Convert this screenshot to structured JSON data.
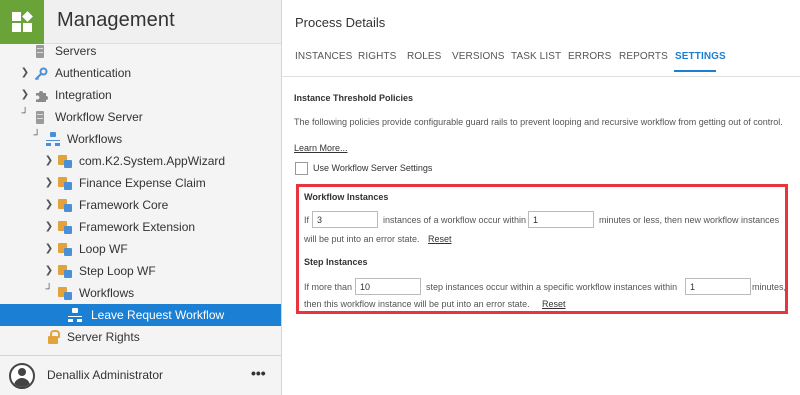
{
  "app": {
    "title": "Management"
  },
  "sidebar": {
    "items": [
      {
        "label": "Servers",
        "icon": "server-icon"
      },
      {
        "label": "Authentication",
        "icon": "key-icon"
      },
      {
        "label": "Integration",
        "icon": "puzzle-icon"
      },
      {
        "label": "Workflow Server",
        "icon": "server-icon"
      },
      {
        "label": "Workflows",
        "icon": "workflow-icon"
      },
      {
        "label": "com.K2.System.AppWizard",
        "icon": "folder-workflow-icon"
      },
      {
        "label": "Finance Expense Claim",
        "icon": "folder-workflow-icon"
      },
      {
        "label": "Framework Core",
        "icon": "folder-workflow-icon"
      },
      {
        "label": "Framework Extension",
        "icon": "folder-workflow-icon"
      },
      {
        "label": "Loop WF",
        "icon": "folder-workflow-icon"
      },
      {
        "label": "Step Loop WF",
        "icon": "folder-workflow-icon"
      },
      {
        "label": "Workflows",
        "icon": "folder-workflow-icon"
      },
      {
        "label": "Leave Request Workflow",
        "icon": "workflow-icon"
      },
      {
        "label": "Server Rights",
        "icon": "lock-icon"
      }
    ],
    "footer": {
      "user_name": "Denallix Administrator",
      "more": "•••"
    }
  },
  "main": {
    "title": "Process Details",
    "tabs": [
      "INSTANCES",
      "RIGHTS",
      "ROLES",
      "VERSIONS",
      "TASK LIST",
      "ERRORS",
      "REPORTS",
      "SETTINGS"
    ],
    "active_tab": "SETTINGS",
    "section_title": "Instance Threshold Policies",
    "section_desc": "The following policies provide configurable guard rails to prevent looping and recursive workflow from getting out of control.",
    "learn_more": "Learn More...",
    "use_settings_label": "Use Workflow Server Settings",
    "use_settings_checked": false,
    "workflow_instances": {
      "heading": "Workflow Instances",
      "prefix": "If",
      "count": "3",
      "mid": "instances of a workflow occur within",
      "minutes": "1",
      "suffix": "minutes or less, then new workflow instances",
      "line2": "will be put into an error state.",
      "reset": "Reset"
    },
    "step_instances": {
      "heading": "Step Instances",
      "prefix": "If more than",
      "count": "10",
      "mid": "step instances occur within a specific workflow instances within",
      "minutes": "1",
      "suffix": "minutes,",
      "line2": "then this workflow instance will be put into an error state.",
      "reset": "Reset"
    },
    "highlight_color": "#e8353d",
    "accent_color": "#1b7fd4"
  }
}
